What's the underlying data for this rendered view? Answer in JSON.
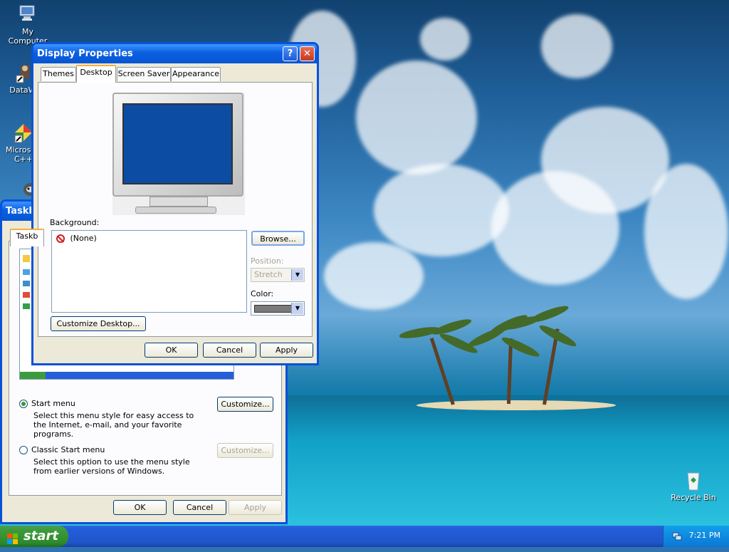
{
  "desktop": {
    "icons": [
      {
        "label": "My Computer"
      },
      {
        "label": "DataWa"
      },
      {
        "label": "Microsoft C++"
      },
      {
        "label": ""
      }
    ],
    "recycle_bin": "Recycle Bin"
  },
  "taskbar_window": {
    "title": "Taskb",
    "tab_label": "Taskb",
    "start_menu_label": "Start menu",
    "start_menu_desc": "Select this menu style for easy access to the Internet, e-mail, and your favorite programs.",
    "start_customize": "Customize...",
    "classic_label": "Classic Start menu",
    "classic_desc": "Select this option to use the menu style from earlier versions of Windows.",
    "classic_customize": "Customize...",
    "ok": "OK",
    "cancel": "Cancel",
    "apply": "Apply"
  },
  "display_properties": {
    "title": "Display Properties",
    "help": "?",
    "close": "✕",
    "tabs": [
      {
        "label": "Themes"
      },
      {
        "label": "Desktop",
        "active": true
      },
      {
        "label": "Screen Saver"
      },
      {
        "label": "Appearance"
      }
    ],
    "background_label": "Background:",
    "background_items": [
      "(None)"
    ],
    "browse": "Browse...",
    "position_label": "Position:",
    "position_value": "Stretch",
    "color_label": "Color:",
    "color_value": "#7a7a7a",
    "customize_desktop": "Customize Desktop...",
    "ok": "OK",
    "cancel": "Cancel",
    "apply": "Apply"
  },
  "taskbar": {
    "start_label": "start",
    "clock": "7:21 PM"
  }
}
